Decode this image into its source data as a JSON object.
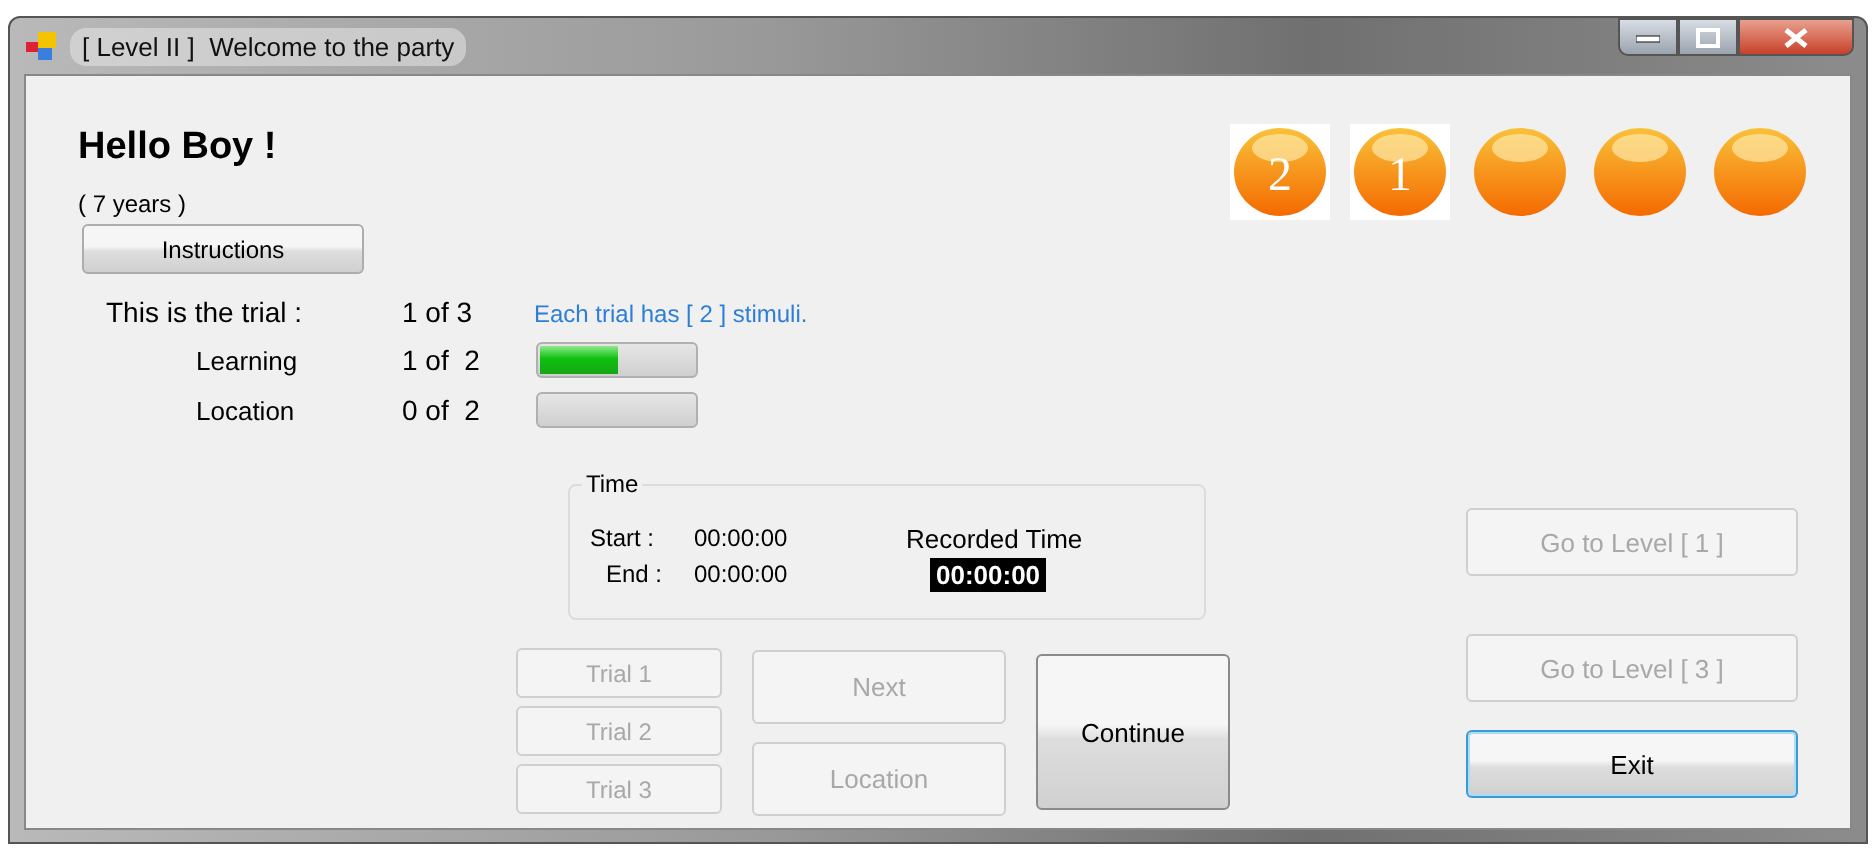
{
  "window": {
    "title": "[ Level II ]  Welcome to the party"
  },
  "greeting": "Hello Boy !",
  "age": "( 7 years )",
  "instructions_button": {
    "label": "Instructions",
    "disabled": false
  },
  "trial": {
    "label": "This is the trial :",
    "count": "1 of 3",
    "note": "Each trial has [ 2 ] stimuli."
  },
  "progress": [
    {
      "label": "Learning",
      "count": "1 of  2",
      "level": 0.5
    },
    {
      "label": "Location",
      "count": "0 of  2",
      "level": 0
    }
  ],
  "levels": [
    {
      "kind": "numbered",
      "label": "2"
    },
    {
      "kind": "numbered",
      "label": "1"
    },
    {
      "kind": "plain"
    },
    {
      "kind": "plain"
    },
    {
      "kind": "plain"
    }
  ],
  "time": {
    "title": "Time",
    "start_label": "Start :",
    "start": "00:00:00",
    "end_label": "End :",
    "end": "00:00:00",
    "recorded_label": "Recorded Time",
    "recorded": "00:00:00"
  },
  "trial_buttons": [
    {
      "label": "Trial 1",
      "disabled": true
    },
    {
      "label": "Trial 2",
      "disabled": true
    },
    {
      "label": "Trial 3",
      "disabled": true
    }
  ],
  "step_buttons": [
    {
      "label": "Next",
      "disabled": true
    },
    {
      "label": "Location",
      "disabled": true
    }
  ],
  "continue_button": {
    "label": "Continue",
    "disabled": false
  },
  "side_buttons": [
    {
      "label": "Go to Level [ 1 ]",
      "disabled": true,
      "focused": false
    },
    {
      "label": "Go to Level [ 3 ]",
      "disabled": true,
      "focused": false
    },
    {
      "label": "Exit",
      "disabled": false,
      "focused": true
    }
  ]
}
